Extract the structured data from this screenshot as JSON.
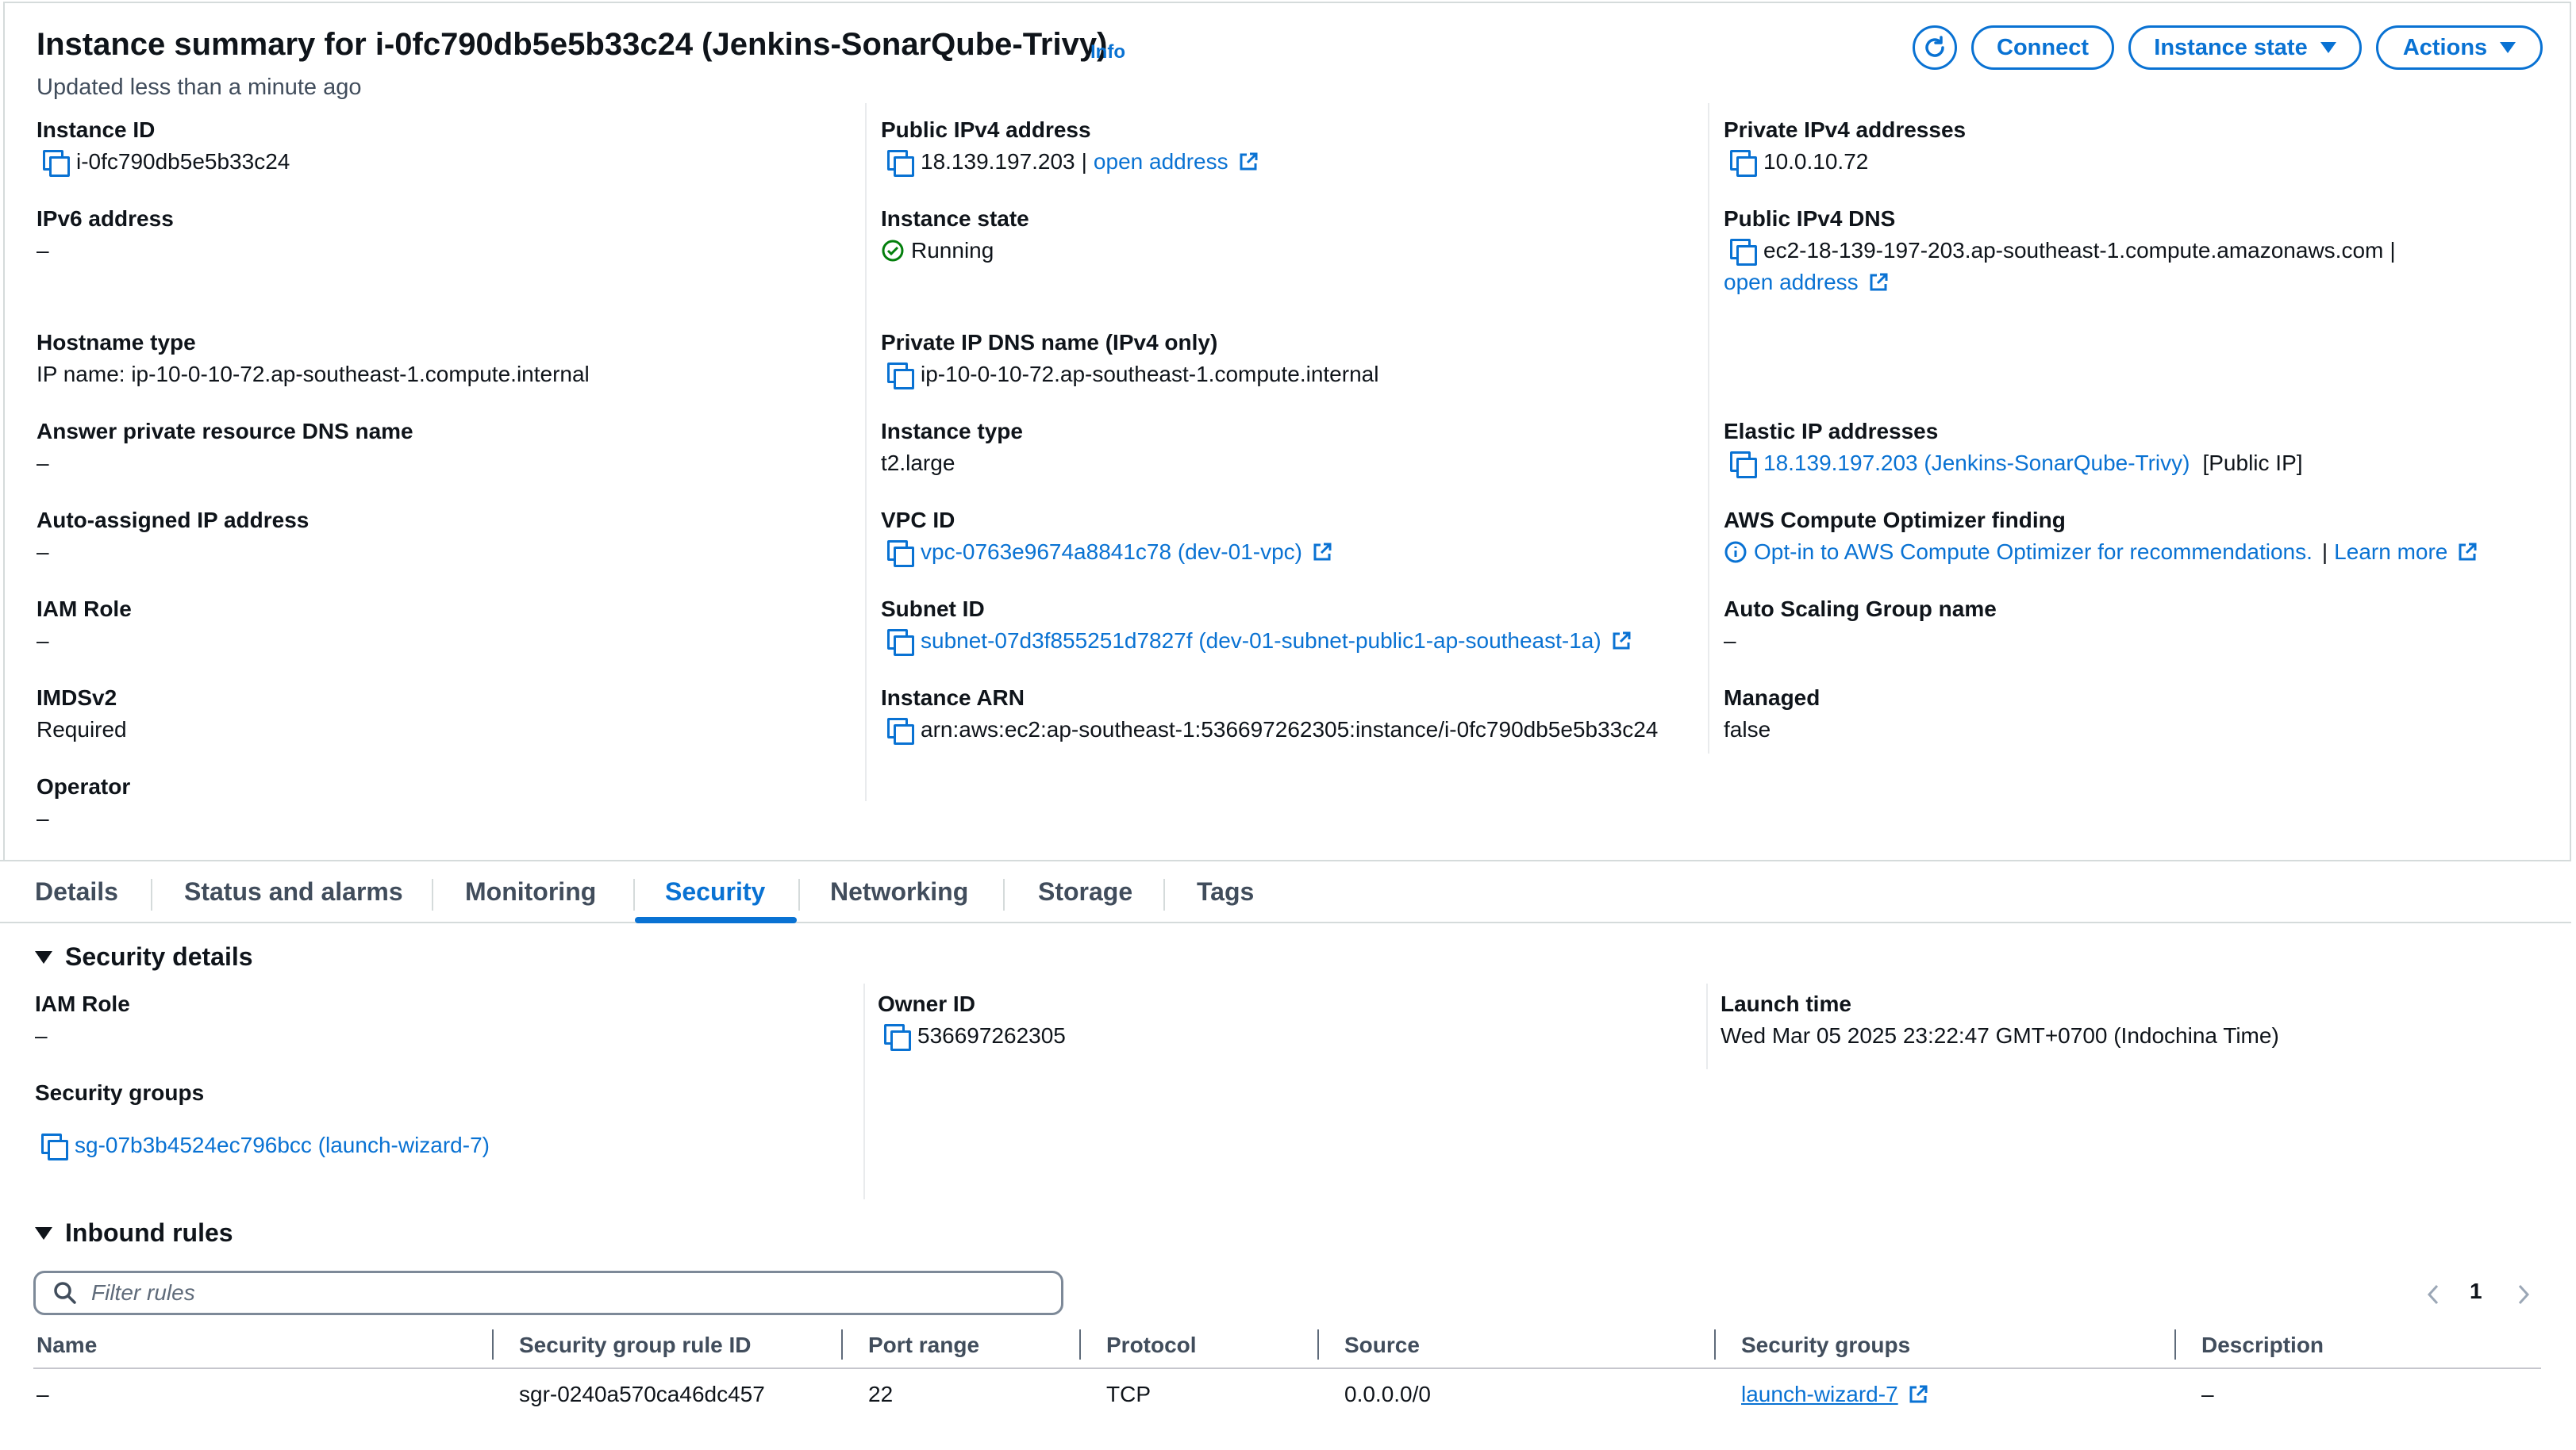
{
  "header": {
    "title": "Instance summary for i-0fc790db5e5b33c24 (Jenkins-SonarQube-Trivy)",
    "info": "Info",
    "updated": "Updated less than a minute ago",
    "buttons": {
      "connect": "Connect",
      "instance_state": "Instance state",
      "actions": "Actions"
    }
  },
  "summary": {
    "col1": [
      {
        "label": "Instance ID",
        "value": "i-0fc790db5e5b33c24"
      },
      {
        "label": "IPv6 address",
        "value": "–"
      },
      {
        "label": "Hostname type",
        "value": "IP name: ip-10-0-10-72.ap-southeast-1.compute.internal"
      },
      {
        "label": "Answer private resource DNS name",
        "value": "–"
      },
      {
        "label": "Auto-assigned IP address",
        "value": "–"
      },
      {
        "label": "IAM Role",
        "value": "–"
      },
      {
        "label": "IMDSv2",
        "value": "Required"
      },
      {
        "label": "Operator",
        "value": "–"
      }
    ],
    "col2": {
      "public_ipv4": {
        "label": "Public IPv4 address",
        "value": "18.139.197.203",
        "sep": "|",
        "link": "open address"
      },
      "instance_state": {
        "label": "Instance state",
        "value": "Running"
      },
      "private_dns": {
        "label": "Private IP DNS name (IPv4 only)",
        "value": "ip-10-0-10-72.ap-southeast-1.compute.internal"
      },
      "instance_type": {
        "label": "Instance type",
        "value": "t2.large"
      },
      "vpc": {
        "label": "VPC ID",
        "value": "vpc-0763e9674a8841c78 (dev-01-vpc)"
      },
      "subnet": {
        "label": "Subnet ID",
        "value": "subnet-07d3f855251d7827f (dev-01-subnet-public1-ap-southeast-1a)"
      },
      "arn": {
        "label": "Instance ARN",
        "value": "arn:aws:ec2:ap-southeast-1:536697262305:instance/i-0fc790db5e5b33c24"
      }
    },
    "col3": {
      "private_ipv4": {
        "label": "Private IPv4 addresses",
        "value": "10.0.10.72"
      },
      "public_dns": {
        "label": "Public IPv4 DNS",
        "value": "ec2-18-139-197-203.ap-southeast-1.compute.amazonaws.com",
        "sep": "|",
        "link": "open address"
      },
      "elastic_ip": {
        "label": "Elastic IP addresses",
        "value": "18.139.197.203 (Jenkins-SonarQube-Trivy)",
        "suffix": "[Public IP]"
      },
      "optimizer": {
        "label": "AWS Compute Optimizer finding",
        "value": "Opt-in to AWS Compute Optimizer for recommendations.",
        "sep": "|",
        "link": "Learn more"
      },
      "asg": {
        "label": "Auto Scaling Group name",
        "value": "–"
      },
      "managed": {
        "label": "Managed",
        "value": "false"
      }
    }
  },
  "tabs": [
    "Details",
    "Status and alarms",
    "Monitoring",
    "Security",
    "Networking",
    "Storage",
    "Tags"
  ],
  "active_tab": "Security",
  "security": {
    "heading": "Security details",
    "iam_role": {
      "label": "IAM Role",
      "value": "–"
    },
    "owner_id": {
      "label": "Owner ID",
      "value": "536697262305"
    },
    "launch_time": {
      "label": "Launch time",
      "value": "Wed Mar 05 2025 23:22:47 GMT+0700 (Indochina Time)"
    },
    "security_groups": {
      "label": "Security groups",
      "value": "sg-07b3b4524ec796bcc (launch-wizard-7)"
    }
  },
  "inbound": {
    "heading": "Inbound rules",
    "filter_placeholder": "Filter rules",
    "page": "1",
    "columns": [
      "Name",
      "Security group rule ID",
      "Port range",
      "Protocol",
      "Source",
      "Security groups",
      "Description"
    ],
    "rows": [
      {
        "name": "–",
        "rule_id": "sgr-0240a570ca46dc457",
        "port": "22",
        "protocol": "TCP",
        "source": "0.0.0.0/0",
        "sg": "launch-wizard-7",
        "description": "–"
      }
    ]
  },
  "colors": {
    "link": "#0972d3",
    "success": "#037f0c",
    "text": "#0f141a",
    "muted": "#414d5c",
    "border": "#d5dbdb"
  }
}
